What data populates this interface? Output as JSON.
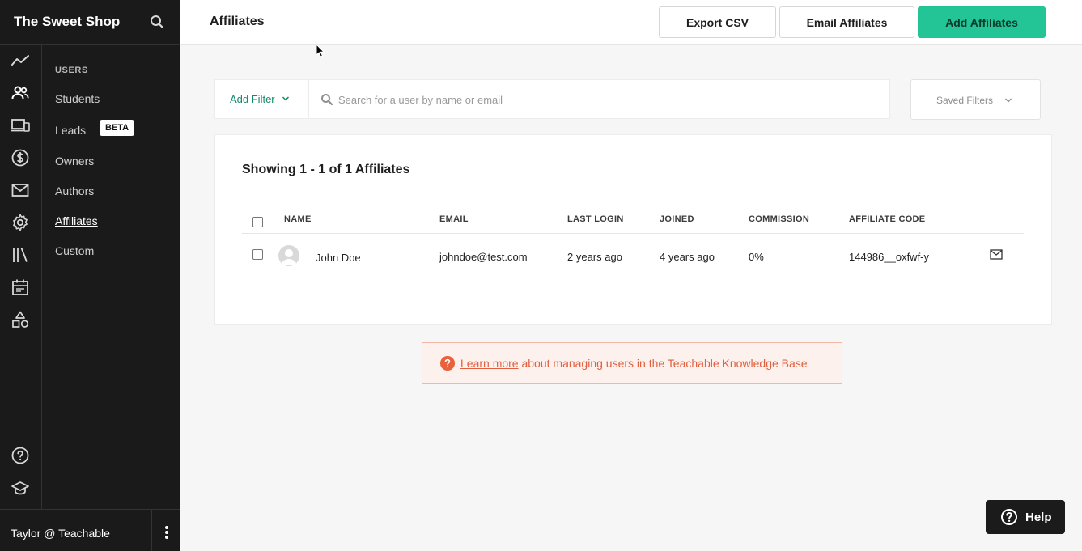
{
  "app": {
    "name": "The Sweet Shop"
  },
  "sidebar": {
    "rail_icons": [
      "trend-line-icon",
      "users-icon",
      "devices-icon",
      "dollar-icon",
      "mail-icon",
      "gear-icon",
      "library-icon",
      "calendar-icon",
      "shapes-icon",
      "help-circle-icon",
      "graduation-cap-icon"
    ],
    "section_heading": "USERS",
    "items": [
      {
        "label": "Students"
      },
      {
        "label": "Leads",
        "badge": "BETA"
      },
      {
        "label": "Owners"
      },
      {
        "label": "Authors"
      },
      {
        "label": "Affiliates",
        "active": true
      },
      {
        "label": "Custom"
      }
    ],
    "user": "Taylor @ Teachable"
  },
  "header": {
    "title": "Affiliates",
    "export_label": "Export CSV",
    "email_label": "Email Affiliates",
    "add_label": "Add Affiliates"
  },
  "filters": {
    "add_filter_label": "Add Filter",
    "search_placeholder": "Search for a user by name or email",
    "saved_filters_label": "Saved Filters"
  },
  "table": {
    "showing": "Showing 1 - 1 of 1 Affiliates",
    "columns": [
      "NAME",
      "EMAIL",
      "LAST LOGIN",
      "JOINED",
      "COMMISSION",
      "AFFILIATE CODE"
    ],
    "rows": [
      {
        "name": "John Doe",
        "email": "johndoe@test.com",
        "last_login": "2 years ago",
        "joined": "4 years ago",
        "commission": "0%",
        "affiliate_code": "144986__oxfwf-y"
      }
    ]
  },
  "kb_banner": {
    "link_text": "Learn more",
    "text": " about managing users in the Teachable Knowledge Base"
  },
  "help": {
    "label": "Help"
  },
  "colors": {
    "accent": "#23c496",
    "sidebar_bg": "#1a1a1a",
    "banner_text": "#e06040",
    "banner_bg": "#fdf1ed"
  }
}
